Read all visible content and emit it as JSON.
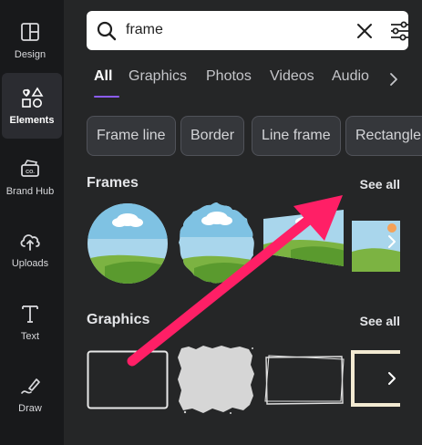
{
  "rail": {
    "items": [
      {
        "label": "Design",
        "icon": "layout-icon"
      },
      {
        "label": "Elements",
        "icon": "shapes-icon",
        "active": true
      },
      {
        "label": "Brand Hub",
        "icon": "brand-hub-icon"
      },
      {
        "label": "Uploads",
        "icon": "upload-cloud-icon"
      },
      {
        "label": "Text",
        "icon": "text-icon"
      },
      {
        "label": "Draw",
        "icon": "draw-icon"
      }
    ]
  },
  "search": {
    "value": "frame"
  },
  "tabs": [
    {
      "label": "All",
      "active": true
    },
    {
      "label": "Graphics"
    },
    {
      "label": "Photos"
    },
    {
      "label": "Videos"
    },
    {
      "label": "Audio"
    }
  ],
  "chips": [
    "Frame line",
    "Border",
    "Line frame",
    "Rectangle"
  ],
  "frames": {
    "title": "Frames",
    "see_all": "See all"
  },
  "graphics": {
    "title": "Graphics",
    "see_all": "See all"
  },
  "colors": {
    "accent": "#8b5cf6",
    "annotation_arrow": "#ff1f66",
    "panel_bg": "#252627",
    "rail_bg": "#18191b"
  }
}
